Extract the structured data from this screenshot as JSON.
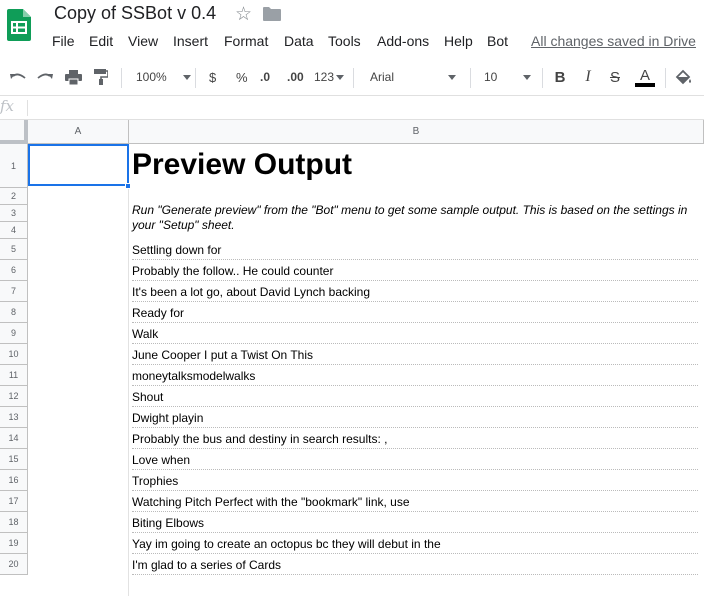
{
  "app": {
    "doc_title": "Copy of SSBot v 0.4",
    "saved_status": "All changes saved in Drive",
    "menu": [
      "File",
      "Edit",
      "View",
      "Insert",
      "Format",
      "Data",
      "Tools",
      "Add-ons",
      "Help",
      "Bot"
    ],
    "accent_color": "#1a73e8",
    "logo_color": "#0f9d58"
  },
  "toolbar": {
    "zoom": "100%",
    "currency": "$",
    "percent": "%",
    "decimal_decrease": ".0",
    "decimal_increase": ".00",
    "more_formats": "123",
    "font": "Arial",
    "font_size": "10",
    "icons": [
      "undo-icon",
      "redo-icon",
      "print-icon",
      "paint-format-icon",
      "bold-icon",
      "italic-icon",
      "strikethrough-icon",
      "text-color-icon",
      "fill-color-icon"
    ]
  },
  "formula_bar": {
    "fx_label": "fx",
    "value": ""
  },
  "grid": {
    "columns": [
      "A",
      "B"
    ],
    "rows": [
      "1",
      "2",
      "3",
      "4",
      "5",
      "6",
      "7",
      "8",
      "9",
      "10",
      "11",
      "12",
      "13",
      "14",
      "15",
      "16",
      "17",
      "18",
      "19",
      "20"
    ],
    "heading": "Preview Output",
    "intro": "Run \"Generate preview\" from the \"Bot\" menu to get some sample output. This is based on the settings in your \"Setup\" sheet.",
    "outputs": [
      "Settling down for",
      "Probably the follow.. He could counter",
      "It's been a lot go, about David Lynch backing",
      "Ready for",
      "Walk",
      "June Cooper I put a Twist On This",
      "moneytalksmodelwalks",
      "Shout",
      "Dwight playin",
      "Probably the bus and destiny in search results: ,",
      "Love when",
      "Trophies",
      "Watching Pitch Perfect with the \"bookmark\" link, use",
      "Biting Elbows",
      "Yay im going to create an octopus bc they will debut in the",
      "I'm glad to a series of Cards"
    ]
  }
}
